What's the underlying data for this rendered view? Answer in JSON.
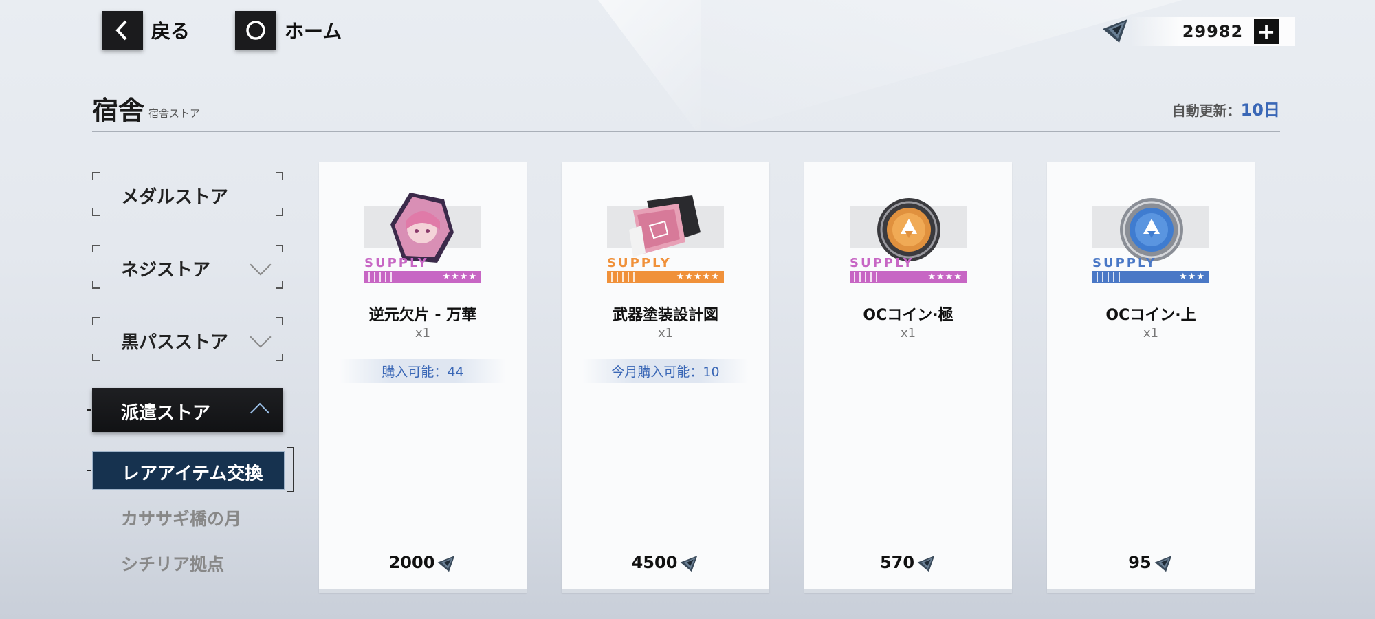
{
  "nav": {
    "back_label": "戻る",
    "home_label": "ホーム"
  },
  "currency": {
    "amount": "29982",
    "icon": "currency-crystal-icon"
  },
  "header": {
    "title": "宿舎",
    "subtitle": "宿舎ストア",
    "refresh_label": "自動更新：",
    "refresh_value": "10日"
  },
  "sidebar": {
    "items": [
      {
        "label": "メダルストア"
      },
      {
        "label": "ネジストア"
      },
      {
        "label": "黒パスストア"
      }
    ],
    "active_category": "派遣ストア",
    "active_sub": "レアアイテム交換",
    "sub_items": [
      {
        "label": "カササギ橋の月"
      },
      {
        "label": "シチリア拠点"
      }
    ]
  },
  "cards": [
    {
      "name": "逆元欠片 - 万華",
      "qty": "x1",
      "limit": "購入可能：44",
      "price": "2000",
      "supply": "SUPPLY",
      "stars": "★★★★",
      "color": "#c766c4",
      "icon": "character-fragment-icon"
    },
    {
      "name": "武器塗装設計図",
      "qty": "x1",
      "limit": "今月購入可能：10",
      "price": "4500",
      "supply": "SUPPLY",
      "stars": "★★★★★",
      "color": "#f0913a",
      "icon": "blueprint-icon"
    },
    {
      "name": "OCコイン·極",
      "qty": "x1",
      "limit": "",
      "price": "570",
      "supply": "SUPPLY",
      "stars": "★★★★",
      "color": "#c766c4",
      "icon": "oc-coin-gold-icon"
    },
    {
      "name": "OCコイン·上",
      "qty": "x1",
      "limit": "",
      "price": "95",
      "supply": "SUPPLY",
      "stars": "★★★",
      "color": "#4a78c6",
      "icon": "oc-coin-blue-icon"
    }
  ]
}
